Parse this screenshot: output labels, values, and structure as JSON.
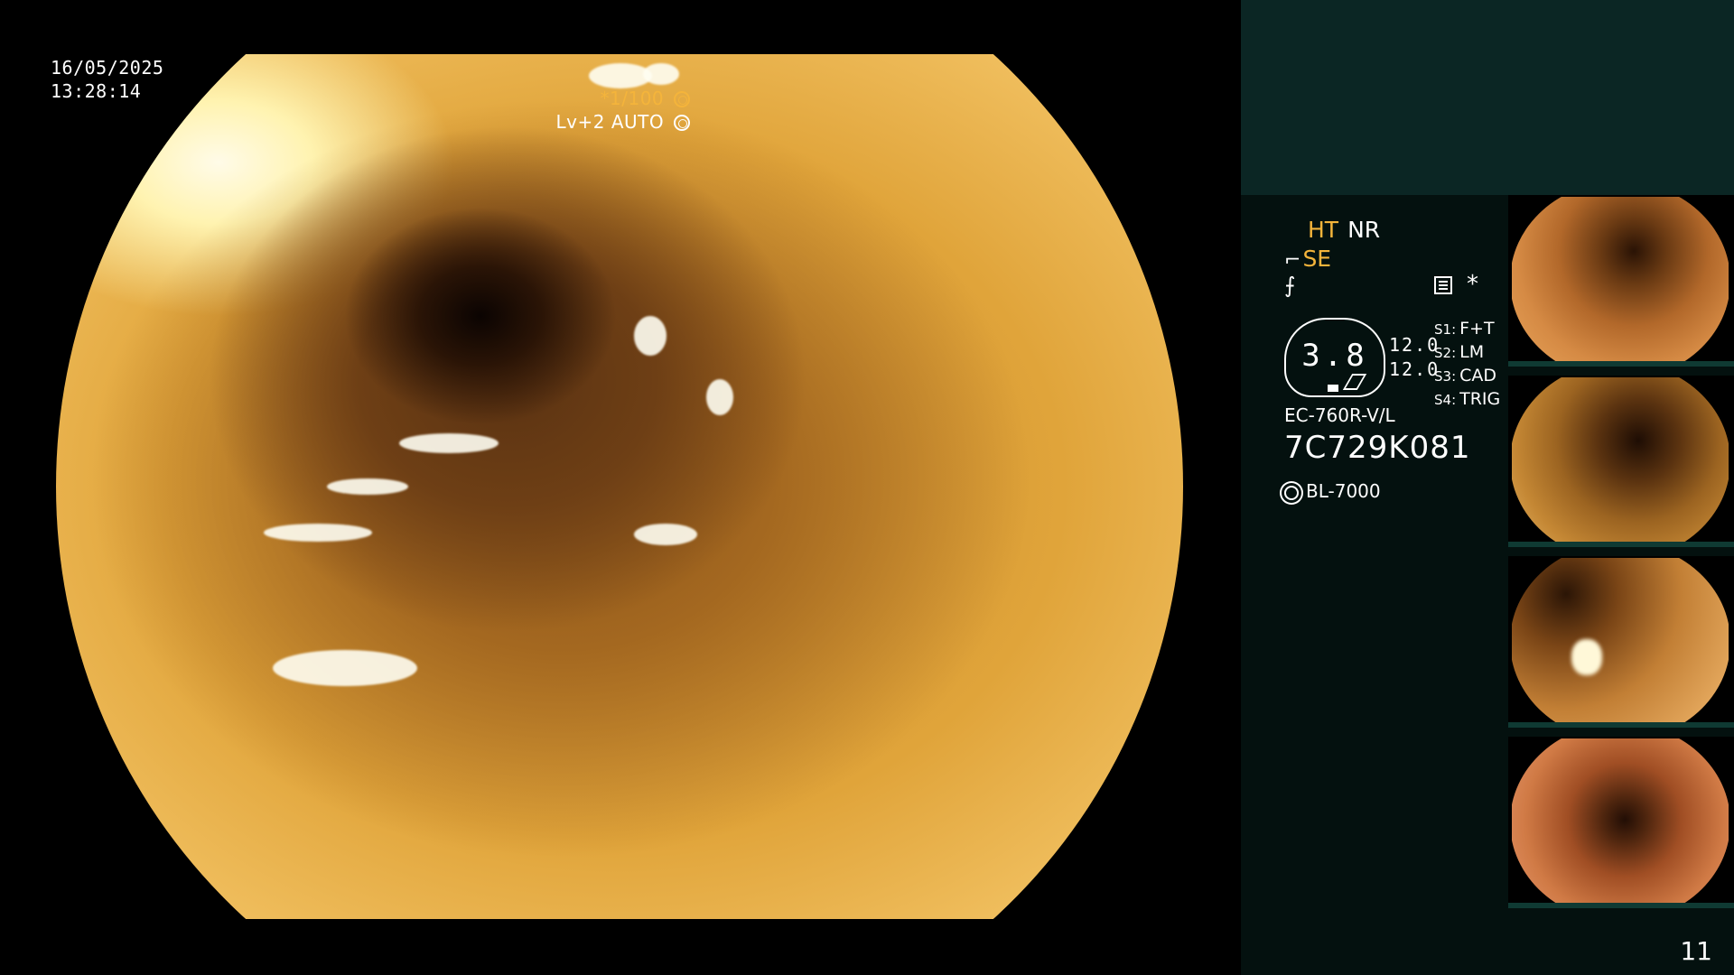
{
  "osd": {
    "date": "16/05/2025",
    "time": "13:28:14",
    "shutter": "*1/100",
    "level": "Lv+2 AUTO"
  },
  "panel": {
    "ht_label": "HT",
    "nr_label": "NR",
    "se_label": "SE",
    "gauge_value": "3.8",
    "value_1": "12.0",
    "value_2": "12.0",
    "presets": [
      {
        "key": "S1:",
        "value": "F+T"
      },
      {
        "key": "S2:",
        "value": "LM"
      },
      {
        "key": "S3:",
        "value": "CAD"
      },
      {
        "key": "S4:",
        "value": "TRIG"
      }
    ],
    "scope_model": "EC-760R-V/L",
    "serial": "7C729K081",
    "light_source": "BL-7000"
  },
  "page_number": "11",
  "colors": {
    "accent": "#f4b43b",
    "panel_bg": "#04110f",
    "panel_top": "#0b2624"
  },
  "icons": [
    "shutter-icon",
    "auto-exposure-icon",
    "menu-icon",
    "star-icon",
    "light-source-icon"
  ]
}
